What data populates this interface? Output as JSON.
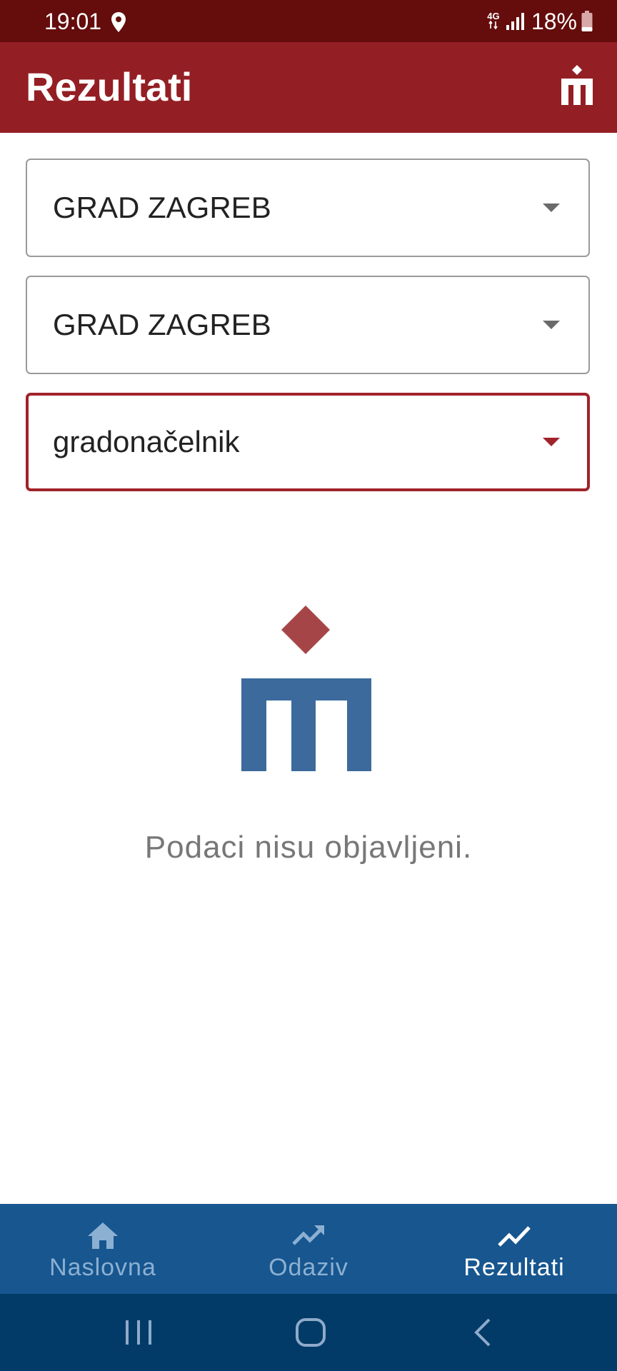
{
  "status_bar": {
    "time": "19:01",
    "network": "4G",
    "battery": "18%"
  },
  "app_bar": {
    "title": "Rezultati"
  },
  "filters": [
    {
      "value": "GRAD ZAGREB"
    },
    {
      "value": "GRAD ZAGREB"
    },
    {
      "value": "gradonačelnik"
    }
  ],
  "empty_state": {
    "message": "Podaci nisu objavljeni."
  },
  "bottom_nav": {
    "items": [
      {
        "label": "Naslovna",
        "icon": "home-icon",
        "active": false
      },
      {
        "label": "Odaziv",
        "icon": "trending-up-icon",
        "active": false
      },
      {
        "label": "Rezultati",
        "icon": "trending-up-icon",
        "active": true
      }
    ]
  },
  "colors": {
    "status_bar": "#650c0c",
    "app_bar": "#931f24",
    "accent": "#a0232b",
    "logo_diamond": "#a64547",
    "logo_blue": "#3c6a9c",
    "bottom_nav": "#17568f",
    "system_nav": "#023b67"
  }
}
